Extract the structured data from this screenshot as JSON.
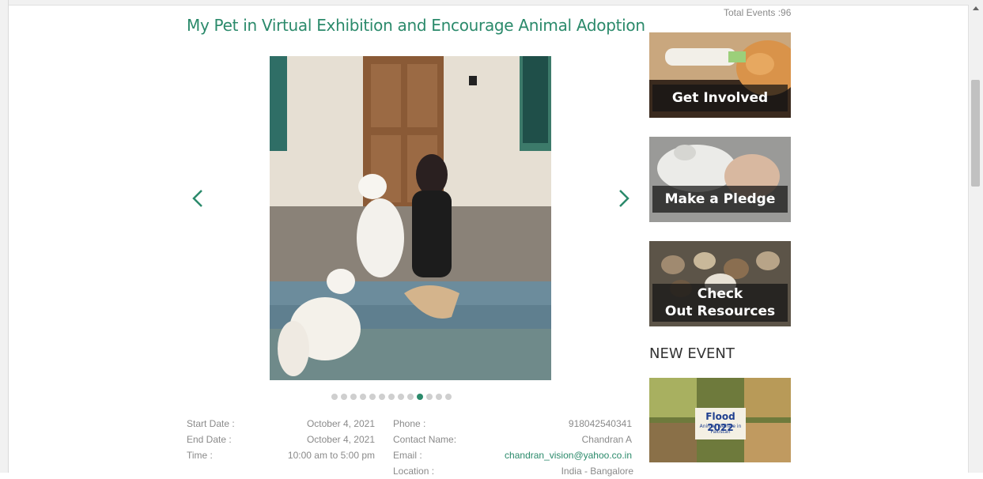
{
  "event": {
    "title": "My Pet in Virtual Exhibition and Encourage Animal Adoption",
    "details": {
      "start_date_label": "Start Date :",
      "start_date": "October 4, 2021",
      "end_date_label": "End Date :",
      "end_date": "October 4, 2021",
      "time_label": "Time :",
      "time": "10:00 am to 5:00 pm",
      "phone_label": "Phone :",
      "phone": "918042540341",
      "contact_label": "Contact Name:",
      "contact": "Chandran A",
      "email_label": "Email :",
      "email": "chandran_vision@yahoo.co.in",
      "location_label": "Location :",
      "location": "India - Bangalore"
    }
  },
  "carousel": {
    "dot_count": 13,
    "active_index": 9,
    "prev_icon": "chevron-left-icon",
    "next_icon": "chevron-right-icon"
  },
  "sidebar": {
    "total_events": "Total Events :96",
    "promos": [
      {
        "label": "Get Involved"
      },
      {
        "label": "Make a Pledge"
      },
      {
        "label_line1": "Check",
        "label_line2": "Out Resources"
      }
    ],
    "new_event_heading": "NEW EVENT",
    "new_event_thumb_text": "Flood 2022",
    "new_event_thumb_subtext": "Animal Welfare in Pakistan"
  },
  "colors": {
    "accent": "#2b8a6b",
    "muted_text": "#8a8a8a"
  }
}
